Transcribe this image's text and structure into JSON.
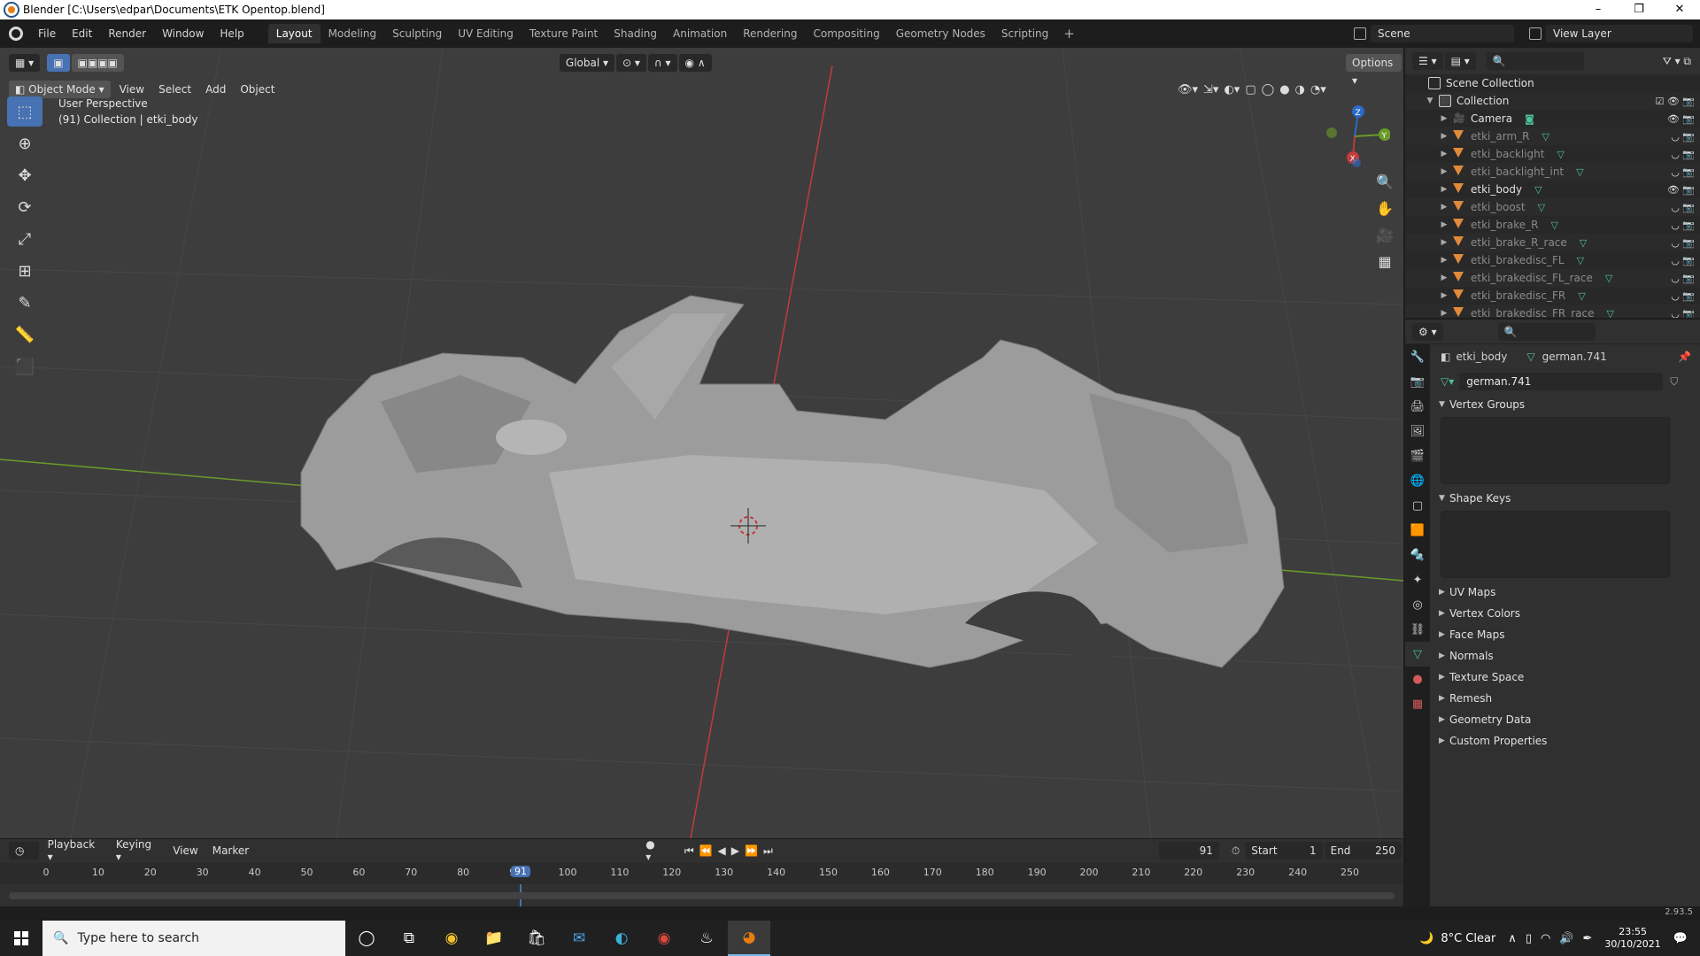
{
  "window": {
    "title": "Blender [C:\\Users\\edpar\\Documents\\ETK Opentop.blend]",
    "min": "–",
    "max": "❐",
    "close": "✕"
  },
  "menu": [
    "File",
    "Edit",
    "Render",
    "Window",
    "Help"
  ],
  "workspaces": [
    "Layout",
    "Modeling",
    "Sculpting",
    "UV Editing",
    "Texture Paint",
    "Shading",
    "Animation",
    "Rendering",
    "Compositing",
    "Geometry Nodes",
    "Scripting"
  ],
  "active_workspace": "Layout",
  "scene": "Scene",
  "view_layer": "View Layer",
  "viewport": {
    "transform_orientation": "Global",
    "options": "Options",
    "mode": "Object Mode",
    "menus": [
      "View",
      "Select",
      "Add",
      "Object"
    ],
    "perspective": "User Perspective",
    "collection_info": "(91) Collection | etki_body",
    "gizmo_axes": {
      "z": "Z",
      "y": "Y",
      "x": "X"
    }
  },
  "timeline": {
    "menus": [
      "Playback",
      "Keying",
      "View",
      "Marker"
    ],
    "current_frame": "91",
    "start_label": "Start",
    "start": "1",
    "end_label": "End",
    "end": "250",
    "ticks": [
      "0",
      "10",
      "20",
      "30",
      "40",
      "50",
      "60",
      "70",
      "80",
      "90",
      "100",
      "110",
      "120",
      "130",
      "140",
      "150",
      "160",
      "170",
      "180",
      "190",
      "200",
      "210",
      "220",
      "230",
      "240",
      "250"
    ],
    "playhead": "91"
  },
  "outliner": {
    "scene_collection": "Scene Collection",
    "collection": "Collection",
    "items": [
      {
        "name": "Camera",
        "type": "camera",
        "dim": false
      },
      {
        "name": "etki_arm_R",
        "type": "mesh",
        "dim": true
      },
      {
        "name": "etki_backlight",
        "type": "mesh",
        "dim": true
      },
      {
        "name": "etki_backlight_int",
        "type": "mesh",
        "dim": true
      },
      {
        "name": "etki_body",
        "type": "mesh",
        "dim": false
      },
      {
        "name": "etki_boost",
        "type": "mesh",
        "dim": true
      },
      {
        "name": "etki_brake_R",
        "type": "mesh",
        "dim": true
      },
      {
        "name": "etki_brake_R_race",
        "type": "mesh",
        "dim": true
      },
      {
        "name": "etki_brakedisc_FL",
        "type": "mesh",
        "dim": true
      },
      {
        "name": "etki_brakedisc_FL_race",
        "type": "mesh",
        "dim": true
      },
      {
        "name": "etki_brakedisc_FR",
        "type": "mesh",
        "dim": true
      },
      {
        "name": "etki_brakedisc_FR_race",
        "type": "mesh",
        "dim": true
      }
    ]
  },
  "properties": {
    "object": "etki_body",
    "mesh": "german.741",
    "data_name": "german.741",
    "panels_open": [
      "Vertex Groups",
      "Shape Keys"
    ],
    "panels_closed": [
      "UV Maps",
      "Vertex Colors",
      "Face Maps",
      "Normals",
      "Texture Space",
      "Remesh",
      "Geometry Data",
      "Custom Properties"
    ]
  },
  "statusbar": {
    "version": "2.93.5"
  },
  "taskbar": {
    "search_placeholder": "Type here to search",
    "weather": "8°C  Clear",
    "time": "23:55",
    "date": "30/10/2021"
  },
  "colors": {
    "accent": "#4772b3",
    "x_axis": "#c23b3b",
    "y_axis": "#6a9a2a",
    "mesh": "#a8a8a8"
  }
}
